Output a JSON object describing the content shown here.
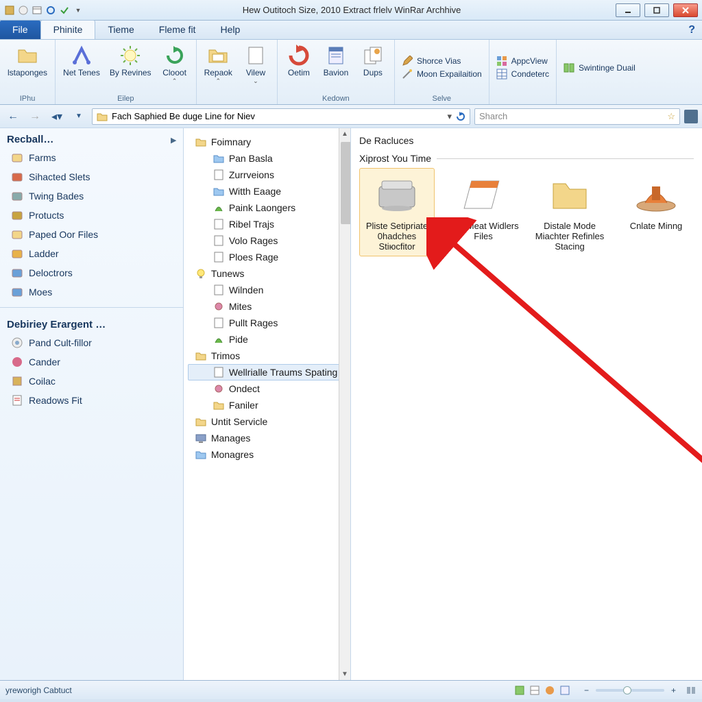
{
  "window": {
    "title": "Hew Outitoch Size, 2010 Extract frlelv WinRar Archhive"
  },
  "menutabs": {
    "file": "File",
    "active": "Phinite",
    "t2": "Tieme",
    "t3": "Fleme fit",
    "t4": "Help"
  },
  "ribbon": {
    "g1": {
      "label": "IPhu",
      "b0": "lstaponges"
    },
    "g2": {
      "label": "Eilep",
      "b0": "Net Tenes",
      "b1": "By Revines",
      "b2": "Clooot"
    },
    "g3": {
      "b0": "Repaok",
      "b1": "Vilew"
    },
    "g4": {
      "label": "Kedown",
      "b0": "Oetim",
      "b1": "Bavion",
      "b2": "Dups"
    },
    "g5": {
      "label": "Selve",
      "s0": "Shorce Vias",
      "s1": "Moon Expailaition"
    },
    "g6": {
      "s0": "AppcView",
      "s1": "Condeterc"
    },
    "g7": {
      "s0": "Swintinge Duail"
    }
  },
  "address": {
    "path": "Fach Saphied Be duge Line for Niev"
  },
  "search": {
    "placeholder": "Sharch"
  },
  "favorites": {
    "head1": "Recball…",
    "items1": [
      "Farms",
      "Sihacted Slets",
      "Twing Bades",
      "Protucts",
      "Paped Oor Files",
      "Ladder",
      "Deloctrors",
      "Moes"
    ],
    "head2": "Debiriey Erargent …",
    "items2": [
      "Pand Cult-fillor",
      "Cander",
      "Coilac",
      "Readows Fit"
    ]
  },
  "tree": [
    {
      "d": 1,
      "label": "Foimnary"
    },
    {
      "d": 2,
      "label": "Pan Basla"
    },
    {
      "d": 2,
      "label": "Zurrveions"
    },
    {
      "d": 2,
      "label": "Witth Eaage"
    },
    {
      "d": 2,
      "label": "Paink Laongers"
    },
    {
      "d": 2,
      "label": "Ribel Trajs"
    },
    {
      "d": 2,
      "label": "Volo Rages"
    },
    {
      "d": 2,
      "label": "Ploes Rage"
    },
    {
      "d": 1,
      "label": "Tunews"
    },
    {
      "d": 2,
      "label": "Wilnden"
    },
    {
      "d": 2,
      "label": "Mites"
    },
    {
      "d": 2,
      "label": "Pullt Rages"
    },
    {
      "d": 2,
      "label": "Pide"
    },
    {
      "d": 1,
      "label": "Trimos"
    },
    {
      "d": 2,
      "label": "Wellrialle Traums Spating",
      "sel": true
    },
    {
      "d": 2,
      "label": "Ondect"
    },
    {
      "d": 2,
      "label": "Faniler"
    },
    {
      "d": 1,
      "label": "Untit Servicle"
    },
    {
      "d": 1,
      "label": "Manages"
    },
    {
      "d": 1,
      "label": "Monagres"
    }
  ],
  "content": {
    "section": "De Racluces",
    "subhead": "Xiprost You Time",
    "thumbs": [
      {
        "label": "Pliste Setipriate 0hadches Stiюcfitor",
        "sel": true
      },
      {
        "label": "Mail Meat Widlers Files"
      },
      {
        "label": "Distale Mode Miachter Refinles Stacing"
      },
      {
        "label": "Cnlate Minng"
      }
    ]
  },
  "status": {
    "text": "yreworigh Cabtuct"
  }
}
